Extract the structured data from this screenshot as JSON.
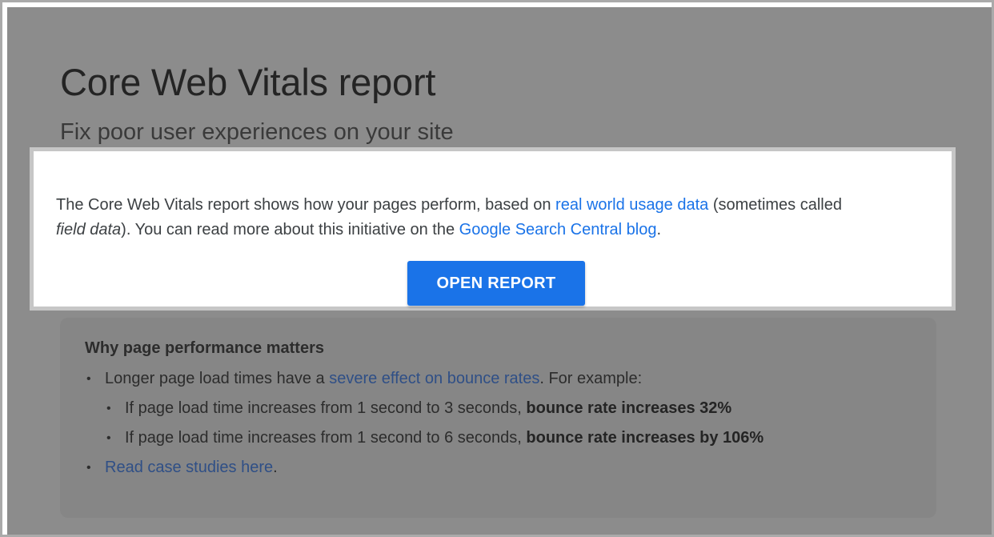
{
  "header": {
    "title": "Core Web Vitals report",
    "subtitle": "Fix poor user experiences on your site"
  },
  "highlight": {
    "text_1": "The Core Web Vitals report shows how your pages perform, based on ",
    "link_1": "real world usage data",
    "text_2": " (sometimes called",
    "italic": "field data",
    "text_3": "). You can read more about this initiative on the ",
    "link_2": "Google Search Central blog",
    "text_4": ".",
    "button_label": "OPEN REPORT"
  },
  "info": {
    "title": "Why page performance matters",
    "bullet_glyph": "•",
    "item_1": {
      "prefix": "Longer page load times have a ",
      "link": "severe effect on bounce rates",
      "suffix": ". For example:"
    },
    "item_1a": {
      "text": "If page load time increases from 1 second to 3 seconds, ",
      "bold": "bounce rate increases 32%"
    },
    "item_1b": {
      "text": "If page load time increases from 1 second to 6 seconds, ",
      "bold": "bounce rate increases by 106%"
    },
    "item_2": {
      "link": "Read case studies here",
      "suffix": "."
    }
  },
  "colors": {
    "overlay_gray": "#8c8c8c",
    "link_blue": "#1a73e8",
    "button_blue": "#1a73e8",
    "dimmed_link": "#2f4f86"
  }
}
